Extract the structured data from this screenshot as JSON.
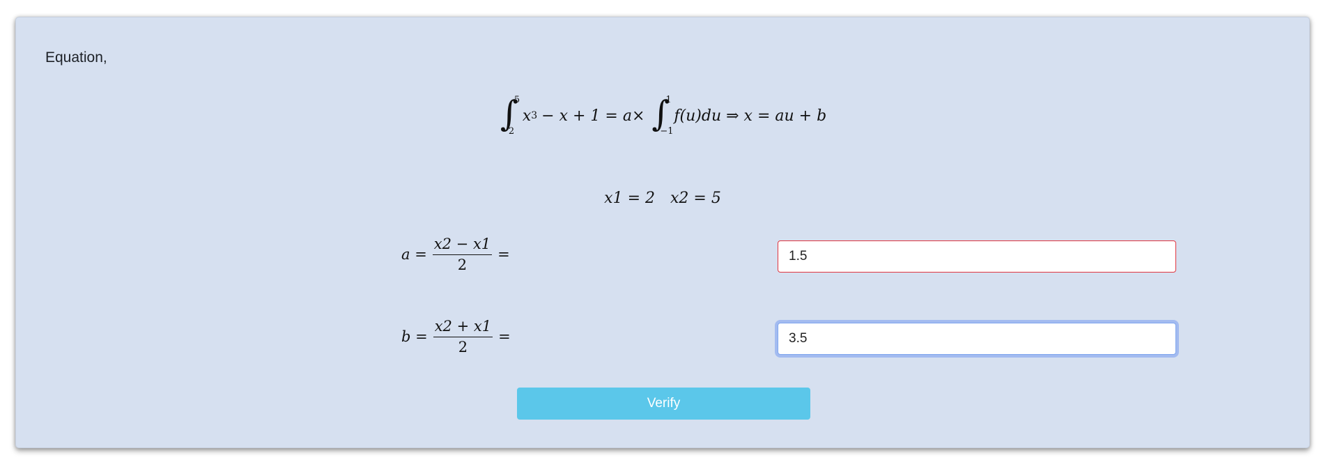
{
  "heading": "Equation,",
  "equation": {
    "integral1_upper": "5",
    "integral1_lower": "2",
    "integrand_base": "x",
    "integrand_exp": "3",
    "integrand_rest": "− x + 1 = a×",
    "integral2_upper": "1",
    "integral2_lower": "−1",
    "integral2_body": "f(u)du ⇒ x = au + b"
  },
  "bounds": {
    "x1": "x1 = 2",
    "x2": "x2 = 5"
  },
  "rows": {
    "a": {
      "lhs": "a =",
      "numerator": "x2 − x1",
      "denominator": "2",
      "eq": "=",
      "value": "1.5"
    },
    "b": {
      "lhs": "b =",
      "numerator": "x2 + x1",
      "denominator": "2",
      "eq": "=",
      "value": "3.5"
    }
  },
  "verify_label": "Verify",
  "colors": {
    "card_background": "#d6e0f0",
    "invalid_border": "#e0343f",
    "focus_ring": "#7fa6ee",
    "button_background": "#5bc7ea"
  }
}
